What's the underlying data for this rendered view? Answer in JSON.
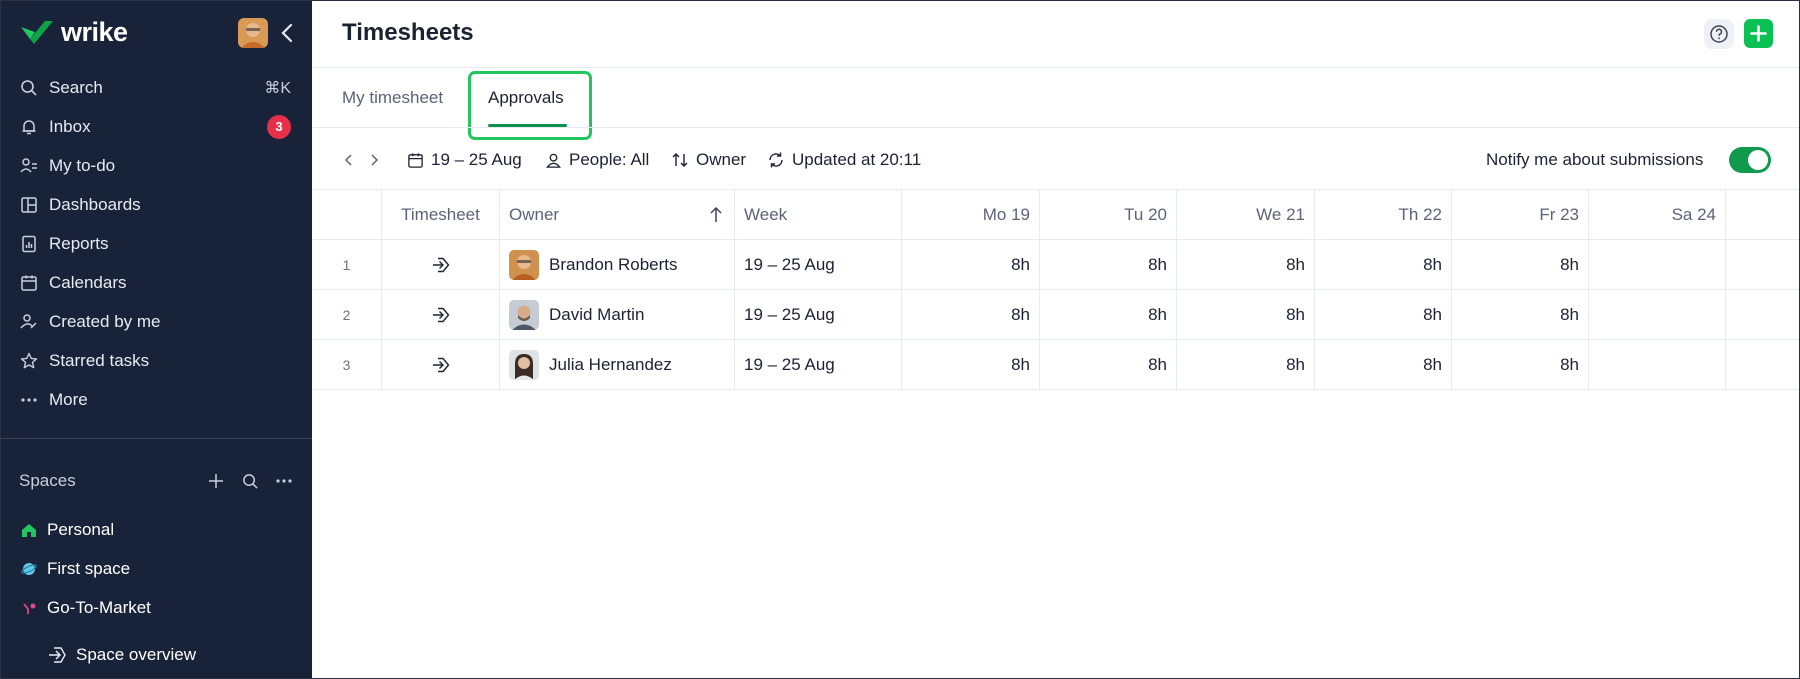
{
  "app": {
    "logo_text": "wrike",
    "page_title": "Timesheets"
  },
  "sidebar": {
    "nav": [
      {
        "label": "Search",
        "icon": "search-icon",
        "shortcut": "⌘K"
      },
      {
        "label": "Inbox",
        "icon": "bell-icon",
        "badge": "3"
      },
      {
        "label": "My to-do",
        "icon": "todo-icon"
      },
      {
        "label": "Dashboards",
        "icon": "dashboard-icon"
      },
      {
        "label": "Reports",
        "icon": "report-icon"
      },
      {
        "label": "Calendars",
        "icon": "calendar-icon"
      },
      {
        "label": "Created by me",
        "icon": "user-created-icon"
      },
      {
        "label": "Starred tasks",
        "icon": "star-icon"
      },
      {
        "label": "More",
        "icon": "ellipsis-icon"
      }
    ],
    "spaces_label": "Spaces",
    "spaces": [
      {
        "label": "Personal",
        "icon": "home-icon",
        "color": "#22c55e"
      },
      {
        "label": "First space",
        "icon": "planet-icon",
        "color": "#5ec9e8"
      },
      {
        "label": "Go-To-Market",
        "icon": "branch-icon",
        "color": "#e0488f"
      }
    ],
    "sub_item": "Space overview"
  },
  "tabs": {
    "my_timesheet": "My timesheet",
    "approvals": "Approvals"
  },
  "toolbar": {
    "date_range": "19 – 25 Aug",
    "people": "People: All",
    "sort": "Owner",
    "updated": "Updated at 20:11",
    "notify": "Notify me about submissions",
    "notify_on": true
  },
  "table": {
    "headers": {
      "timesheet": "Timesheet",
      "owner": "Owner",
      "week": "Week",
      "d1": "Mo 19",
      "d2": "Tu 20",
      "d3": "We 21",
      "d4": "Th 22",
      "d5": "Fr 23",
      "d6": "Sa 24"
    },
    "rows": [
      {
        "num": "1",
        "owner": "Brandon Roberts",
        "week": "19 – 25 Aug",
        "d1": "8h",
        "d2": "8h",
        "d3": "8h",
        "d4": "8h",
        "d5": "8h",
        "d6": ""
      },
      {
        "num": "2",
        "owner": "David Martin",
        "week": "19 – 25 Aug",
        "d1": "8h",
        "d2": "8h",
        "d3": "8h",
        "d4": "8h",
        "d5": "8h",
        "d6": ""
      },
      {
        "num": "3",
        "owner": "Julia Hernandez",
        "week": "19 – 25 Aug",
        "d1": "8h",
        "d2": "8h",
        "d3": "8h",
        "d4": "8h",
        "d5": "8h",
        "d6": ""
      }
    ]
  },
  "colors": {
    "sidebar_bg": "#182238",
    "accent_green": "#0cc154",
    "badge_red": "#e6304a"
  }
}
